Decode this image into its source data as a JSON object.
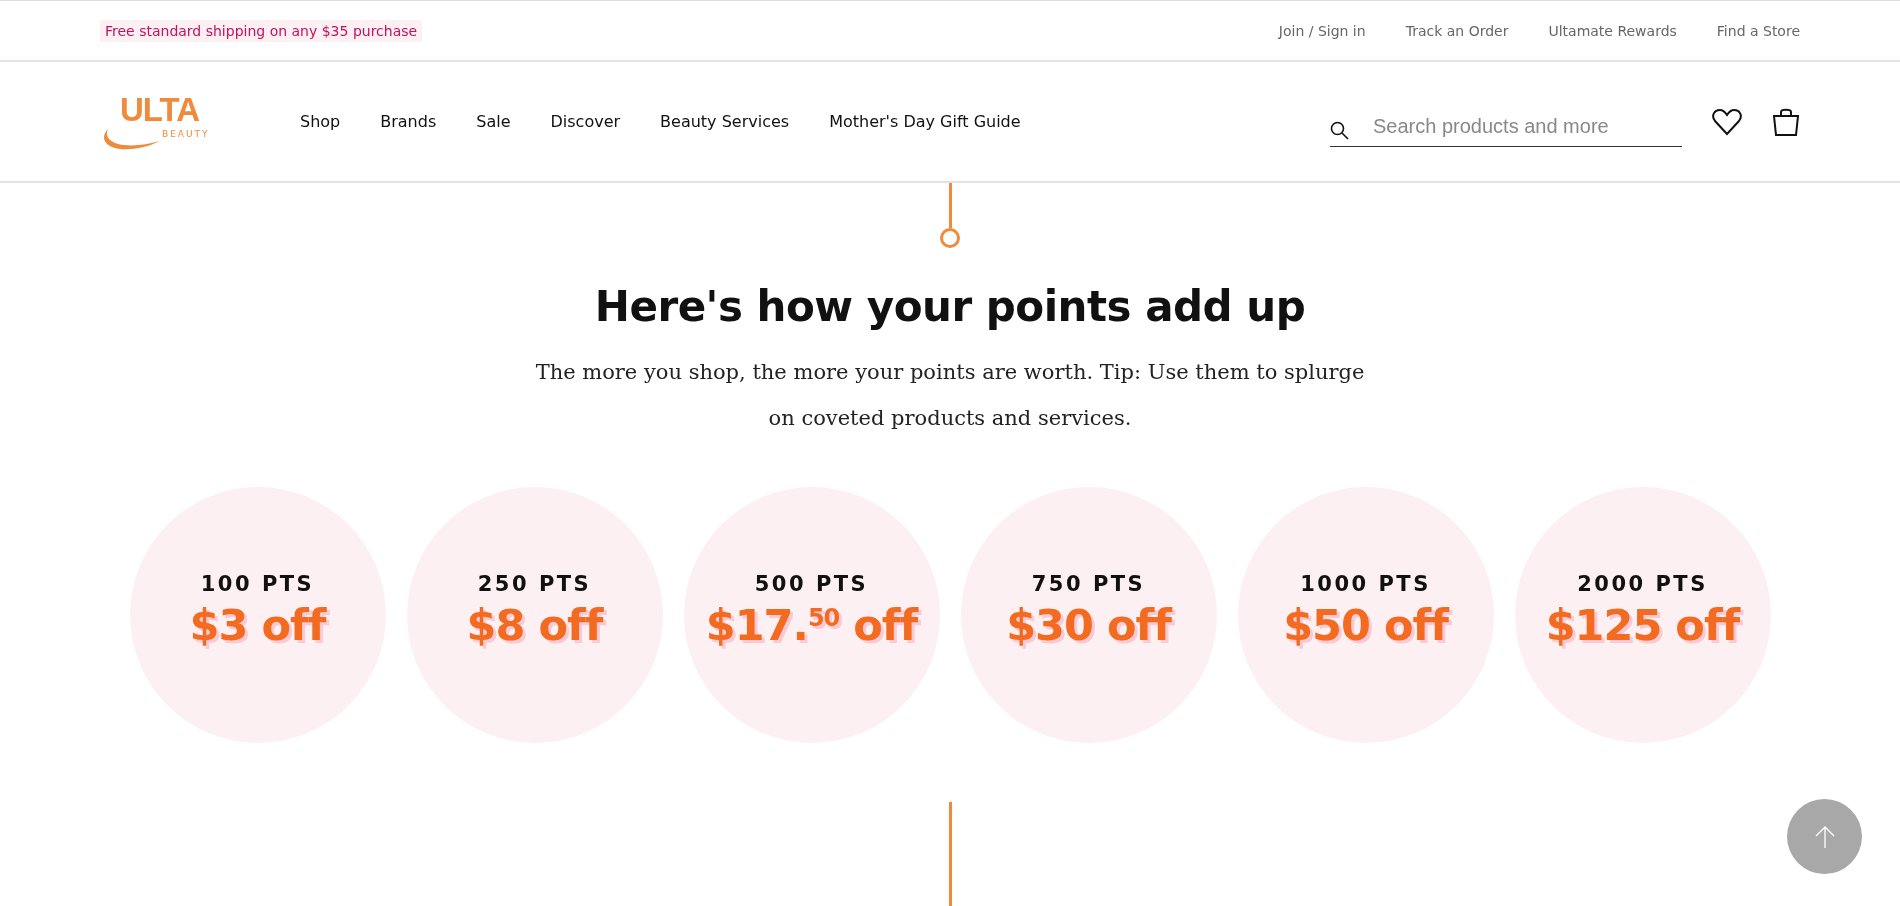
{
  "promo": "Free standard shipping on any $35 purchase",
  "utility_links": [
    "Join / Sign in",
    "Track an Order",
    "Ultamate Rewards",
    "Find a Store"
  ],
  "logo": {
    "wordmark": "ULTA",
    "subtitle": "BEAUTY"
  },
  "nav": [
    "Shop",
    "Brands",
    "Sale",
    "Discover",
    "Beauty Services",
    "Mother's Day Gift Guide"
  ],
  "search": {
    "placeholder": "Search products and more"
  },
  "heading": "Here's how your points add up",
  "intro": "The more you shop, the more your points are worth. Tip: Use them to splurge on coveted products and services.",
  "rewards": [
    {
      "points": "100 PTS",
      "value": "$3 off"
    },
    {
      "points": "250 PTS",
      "value": "$8 off"
    },
    {
      "points": "500 PTS",
      "value": "$17.$^{50}$ off"
    },
    {
      "points": "750 PTS",
      "value": "$30 off"
    },
    {
      "points": "1000 PTS",
      "value": "$50 off"
    },
    {
      "points": "2000 PTS",
      "value": "$125 off"
    }
  ]
}
